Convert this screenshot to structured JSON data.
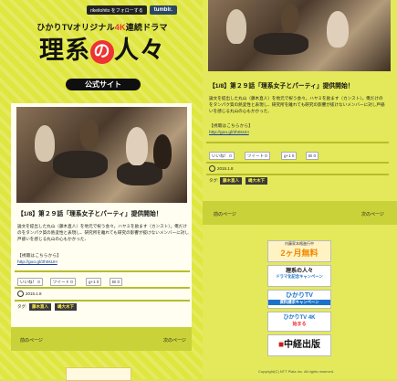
{
  "topbar": {
    "follow_label": "rikeitohito をフォローする",
    "tumblr_label": "tumblr."
  },
  "brand": {
    "subtitle_pre": "ひかりTVオリジナル",
    "subtitle_4k": "4K",
    "subtitle_post": "連続ドラマ",
    "title_a": "理系",
    "title_no": "の",
    "title_b": "人々",
    "official": "公式サイト"
  },
  "post": {
    "title": "【1/8】第２９話「理系女子とパーティ」提供開始！",
    "body": "論文を提出した丸山（藤木直人）を地元で祝う会々。ハヤミを励ます（カンスト）。俺だけのをタンパク質の熱変性と表現し、研究所を離れても研究の影響が抜けないメンバーに対し戸惑いを感じる丸山の心もかかった、",
    "watch_label": "【視聴はこちらから】",
    "link": "http://goo.gl/3h0sUH",
    "date": "2015.1.8",
    "tag_label": "タグ:",
    "tags": [
      "藤木直人",
      "嶋大木下"
    ],
    "share": {
      "like": "いいね！",
      "like_count": "0",
      "tweet": "ツイート",
      "tweet_count": "0",
      "gplus": "0",
      "hatena": "B!",
      "hatena_count": "0"
    }
  },
  "nav": {
    "prev": "前のページ",
    "next": "次のページ"
  },
  "banners": [
    {
      "top": "内藤家本格進行中",
      "main": "2ヶ月無料",
      "color": "#f08a00"
    },
    {
      "top": "理系の人々",
      "main": "ドラマ化記念キャンペーン",
      "color": "#1a73c9"
    },
    {
      "top": "ひかりTV",
      "main": "資料請求キャンペーン",
      "color": "#1a73c9"
    },
    {
      "top": "ひかりTV 4K",
      "main": "始まる",
      "color": "#1a73c9"
    },
    {
      "top": "",
      "main": "中経出版",
      "color": "#cc1a1a"
    }
  ],
  "footer": "Copyright(C) NTT Plala Inc. All rights reserved.",
  "colors": {
    "bg": "#dfe63f",
    "accent": "#e33333",
    "dark": "#111111"
  }
}
